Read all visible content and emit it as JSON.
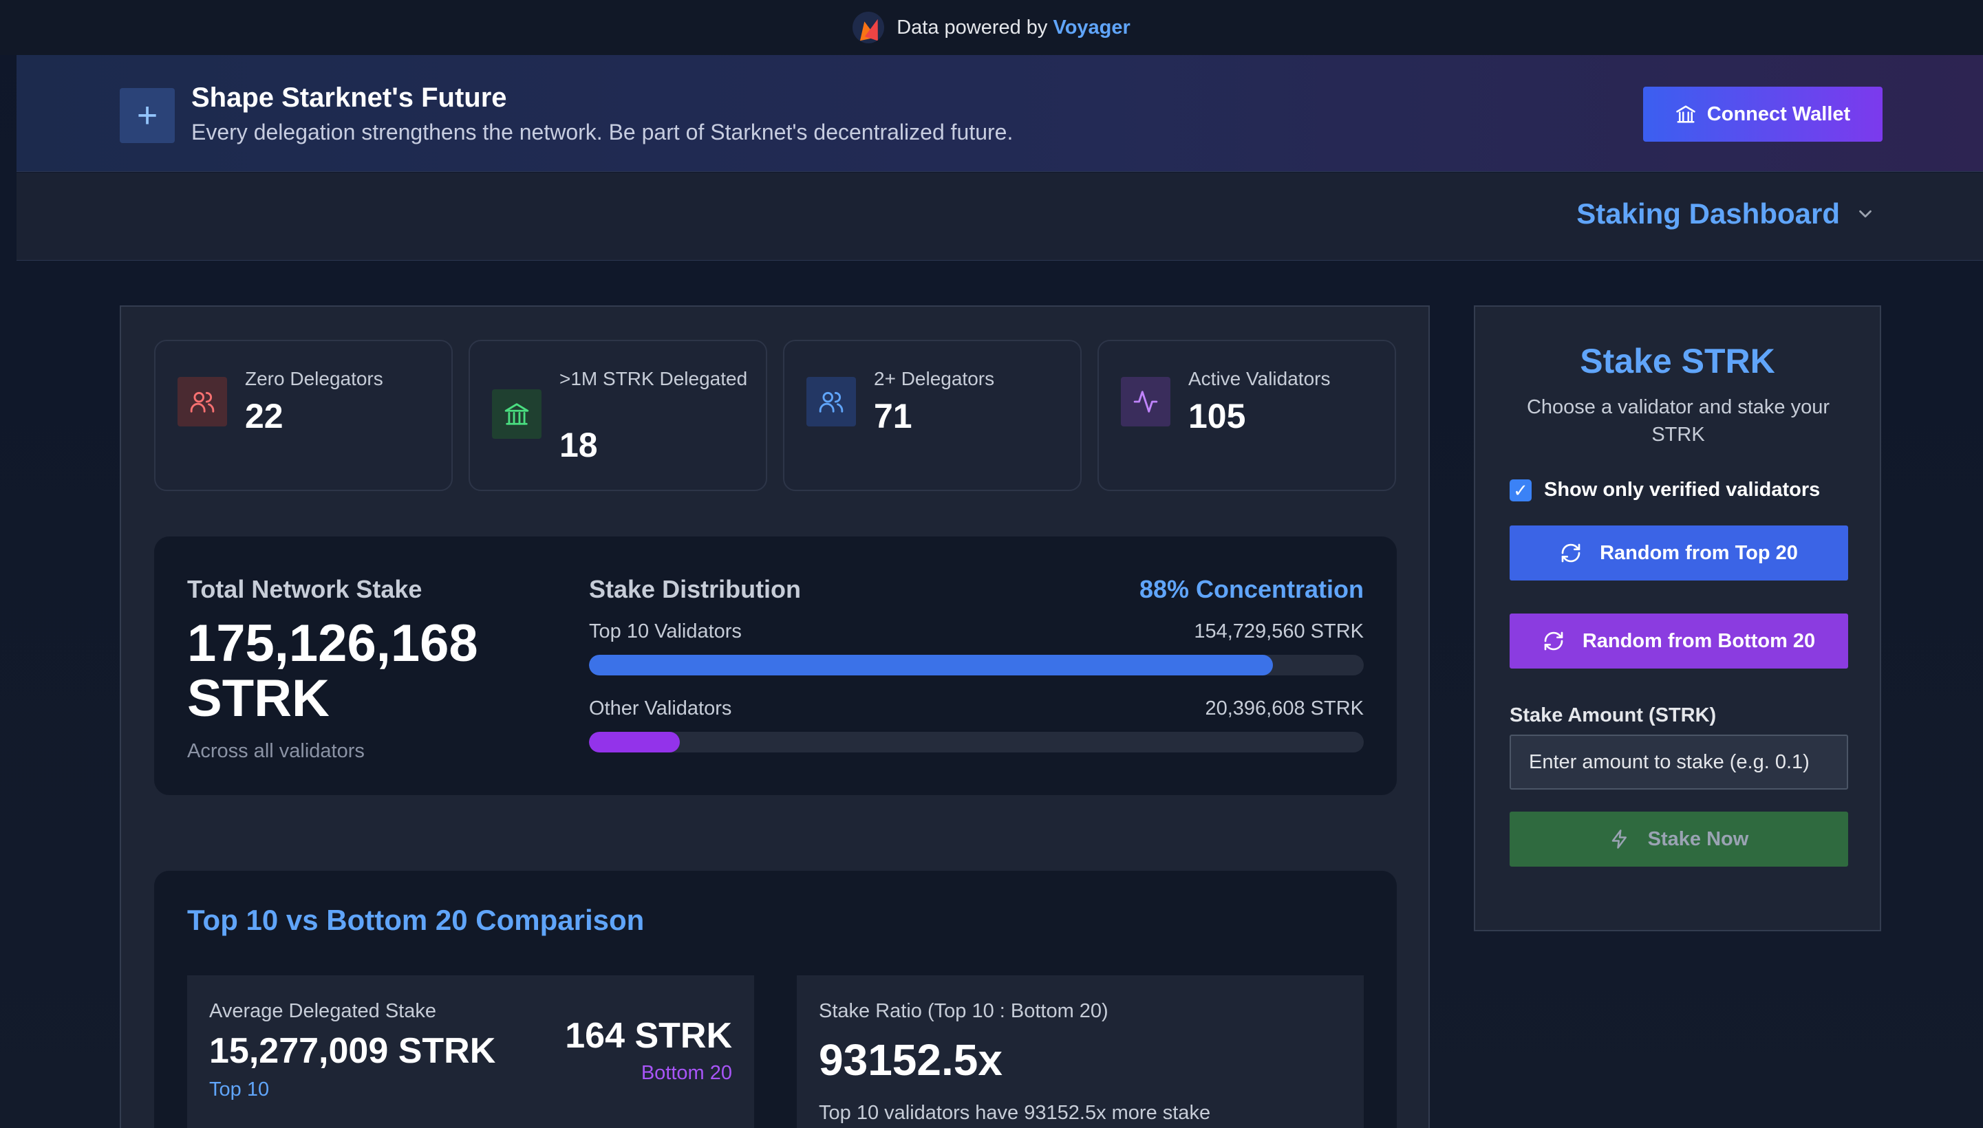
{
  "powered": {
    "prefix": "Data powered by",
    "brand": "Voyager"
  },
  "banner": {
    "title": "Shape Starknet's Future",
    "subtitle": "Every delegation strengthens the network. Be part of Starknet's decentralized future.",
    "connect_label": "Connect Wallet",
    "plus_glyph": "+"
  },
  "nav": {
    "dashboard_label": "Staking Dashboard"
  },
  "stats": [
    {
      "label": "Zero Delegators",
      "value": "22",
      "icon": "users-icon",
      "color": "#f87171"
    },
    {
      "label": ">1M STRK Delegated",
      "value": "18",
      "icon": "bank-icon",
      "color": "#4ade80"
    },
    {
      "label": "2+ Delegators",
      "value": "71",
      "icon": "users-icon",
      "color": "#60a5fa"
    },
    {
      "label": "Active Validators",
      "value": "105",
      "icon": "activity-icon",
      "color": "#c084fc"
    }
  ],
  "network": {
    "title": "Total Network Stake",
    "total": "175,126,168 STRK",
    "subtitle": "Across all validators",
    "dist_title": "Stake Distribution",
    "concentration": "88% Concentration",
    "rows": [
      {
        "name": "Top 10 Validators",
        "amount": "154,729,560 STRK",
        "fraction": 0.883,
        "color": "#3b72e8"
      },
      {
        "name": "Other Validators",
        "amount": "20,396,608 STRK",
        "fraction": 0.117,
        "color": "#9333ea"
      }
    ]
  },
  "comparison": {
    "title": "Top 10 vs Bottom 20 Comparison",
    "avg_label": "Average Delegated Stake",
    "top_value": "15,277,009 STRK",
    "top_label": "Top 10",
    "bottom_value": "164 STRK",
    "bottom_label": "Bottom 20",
    "ratio_label": "Stake Ratio (Top 10 : Bottom 20)",
    "ratio_value": "93152.5x",
    "ratio_desc": "Top 10 validators have 93152.5x more stake"
  },
  "stake_panel": {
    "title": "Stake STRK",
    "description": "Choose a validator and stake your STRK",
    "verified_label": "Show only verified validators",
    "verified_checked": true,
    "btn_top": "Random from Top 20",
    "btn_bottom": "Random from Bottom 20",
    "amount_label": "Stake Amount (STRK)",
    "amount_placeholder": "Enter amount to stake (e.g. 0.1)",
    "stake_now": "Stake Now"
  }
}
